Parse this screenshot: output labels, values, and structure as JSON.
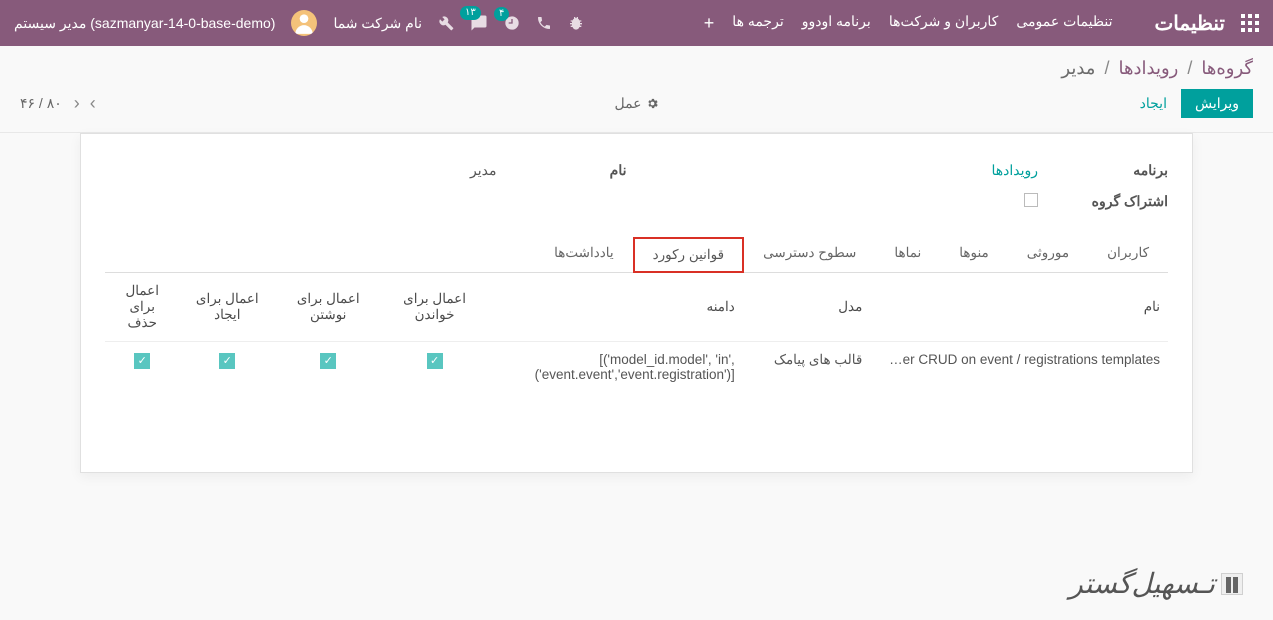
{
  "navbar": {
    "brand": "تنظیمات",
    "menu": [
      "تنظیمات عمومی",
      "کاربران و شرکت‌ها",
      "برنامه اودوو",
      "ترجمه ها"
    ],
    "plus": "+",
    "badge_clock": "۴",
    "badge_chat": "۱۳",
    "company": "نام شرکت شما",
    "user": "مدیر سیستم (sazmanyar-14-0-base-demo)"
  },
  "breadcrumb": {
    "root": "گروه‌ها",
    "mid": "رویدادها",
    "current": "مدیر"
  },
  "controls": {
    "edit": "ویرایش",
    "create": "ایجاد",
    "action": "عمل",
    "page_current": "۴۶",
    "page_total": "۸۰"
  },
  "form": {
    "app_label": "برنامه",
    "app_value": "رویدادها",
    "name_label": "نام",
    "name_value": "مدیر",
    "share_label": "اشتراک گروه"
  },
  "tabs": [
    "کاربران",
    "موروثی",
    "منوها",
    "نماها",
    "سطوح دسترسی",
    "قوانین رکورد",
    "یادداشت‌ها"
  ],
  "active_tab_index": 5,
  "table": {
    "headers": {
      "name": "نام",
      "model": "مدل",
      "domain": "دامنه",
      "read": "اعمال برای خواندن",
      "write": "اعمال برای نوشتن",
      "create": "اعمال برای ایجاد",
      "delete": "اعمال برای حذف"
    },
    "rows": [
      {
        "name": "…er CRUD on event / registrations templates",
        "model": "قالب های پیامک",
        "domain": "[('model_id.model', 'in', ('event.event','event.registration')]",
        "read": true,
        "write": true,
        "create": true,
        "delete": true
      }
    ]
  },
  "footer_logo": "تـسهیل‌گستر"
}
